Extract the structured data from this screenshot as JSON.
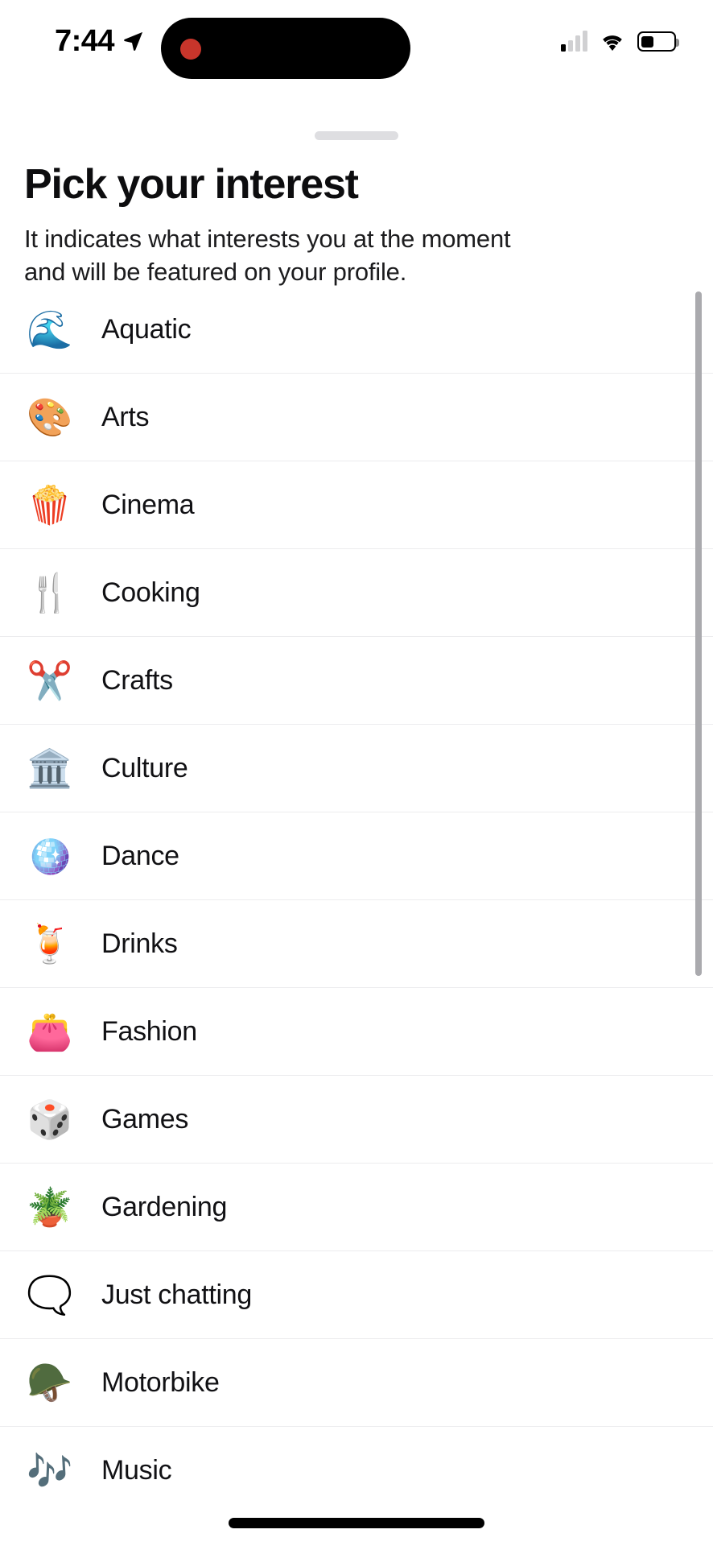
{
  "status_bar": {
    "time": "7:44",
    "location_icon": "location-arrow-icon",
    "recording_indicator": "recording-dot",
    "signal_icon": "cellular-signal-icon",
    "signal_bars_active": 1,
    "signal_bars_total": 4,
    "wifi_icon": "wifi-icon",
    "battery_icon": "battery-icon",
    "battery_level_percent": 35
  },
  "sheet": {
    "grabber": "drag-handle",
    "title": "Pick your interest",
    "subtitle": "It indicates what interests you at the moment and will be featured on your profile."
  },
  "interests": [
    {
      "emoji": "🌊",
      "icon_name": "wave-emoji",
      "label": "Aquatic"
    },
    {
      "emoji": "🎨",
      "icon_name": "artist-palette-emoji",
      "label": "Arts"
    },
    {
      "emoji": "🍿",
      "icon_name": "popcorn-emoji",
      "label": "Cinema"
    },
    {
      "emoji": "🍴",
      "icon_name": "fork-and-knife-emoji",
      "label": "Cooking"
    },
    {
      "emoji": "✂️",
      "icon_name": "scissors-emoji",
      "label": "Crafts"
    },
    {
      "emoji": "🏛️",
      "icon_name": "classical-building-emoji",
      "label": "Culture"
    },
    {
      "emoji": "🪩",
      "icon_name": "mirror-ball-emoji",
      "label": "Dance"
    },
    {
      "emoji": "🍹",
      "icon_name": "tropical-drink-emoji",
      "label": "Drinks"
    },
    {
      "emoji": "👛",
      "icon_name": "handbag-emoji",
      "label": "Fashion"
    },
    {
      "emoji": "🎲",
      "icon_name": "game-die-emoji",
      "label": "Games"
    },
    {
      "emoji": "🪴",
      "icon_name": "potted-plant-emoji",
      "label": "Gardening"
    },
    {
      "emoji": "🗨️",
      "icon_name": "speech-balloon-bla-emoji",
      "label": "Just chatting"
    },
    {
      "emoji": "🪖",
      "icon_name": "racing-helmet-emoji",
      "label": "Motorbike"
    },
    {
      "emoji": "🎶",
      "icon_name": "musical-notes-emoji",
      "label": "Music"
    }
  ],
  "scrollbar": {
    "name": "vertical-scrollbar"
  },
  "home_indicator": {
    "name": "home-indicator"
  },
  "colors": {
    "background": "#ffffff",
    "title": "#0d0d0f",
    "subtitle": "#1c1c1e",
    "divider": "#ececee",
    "grabber": "#dedee1",
    "scrollbar": "#aaaaae",
    "recording_dot": "#c8352b"
  }
}
